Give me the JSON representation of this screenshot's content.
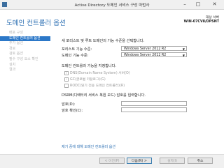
{
  "window": {
    "title": "Active Directory 도메인 서비스 구성 마법사"
  },
  "page_title": "도메인 컨트롤러 옵션",
  "target": {
    "label": "대상 서버",
    "server": "WIN-07CV8/DPSNT"
  },
  "nav": [
    "배포 구성",
    "도메인 컨트롤러 옵션",
    "추가 옵션",
    "경로",
    "검토 옵션",
    "필수 구성 요소 확인",
    "설치",
    "결과"
  ],
  "content": {
    "intro": "새 포리스트 및 루트 도메인의 기능 수준을 선택합니다.",
    "forest_level_label": "포리스트 기능 수준:",
    "forest_level_value": "Windows Server 2012 R2",
    "domain_level_label": "도메인 기능 수준:",
    "domain_level_value": "Windows Server 2012 R2",
    "capabilities_heading": "도메인 컨트롤러 기능을 지정합니다.",
    "dns_label": "DNS(Domain Name System) 서버(O)",
    "gc_label": "GC(글로벌 카탈로그)(G)",
    "rodc_label": "RODC(읽기 전용 도메인 컨트롤러)(R)",
    "dsrm_heading": "DSRM(디렉터리 서비스 복원 모드) 암호를 입력합니다.",
    "password_label": "암호(D):",
    "confirm_label": "암호 확인(C):"
  },
  "more_link": "제기 중에 대해 도메인 컨트롤러 옵션",
  "buttons": {
    "prev": "< 이전(P)",
    "next": "다음(N) >",
    "install": "설치(I)",
    "cancel": "취소"
  }
}
